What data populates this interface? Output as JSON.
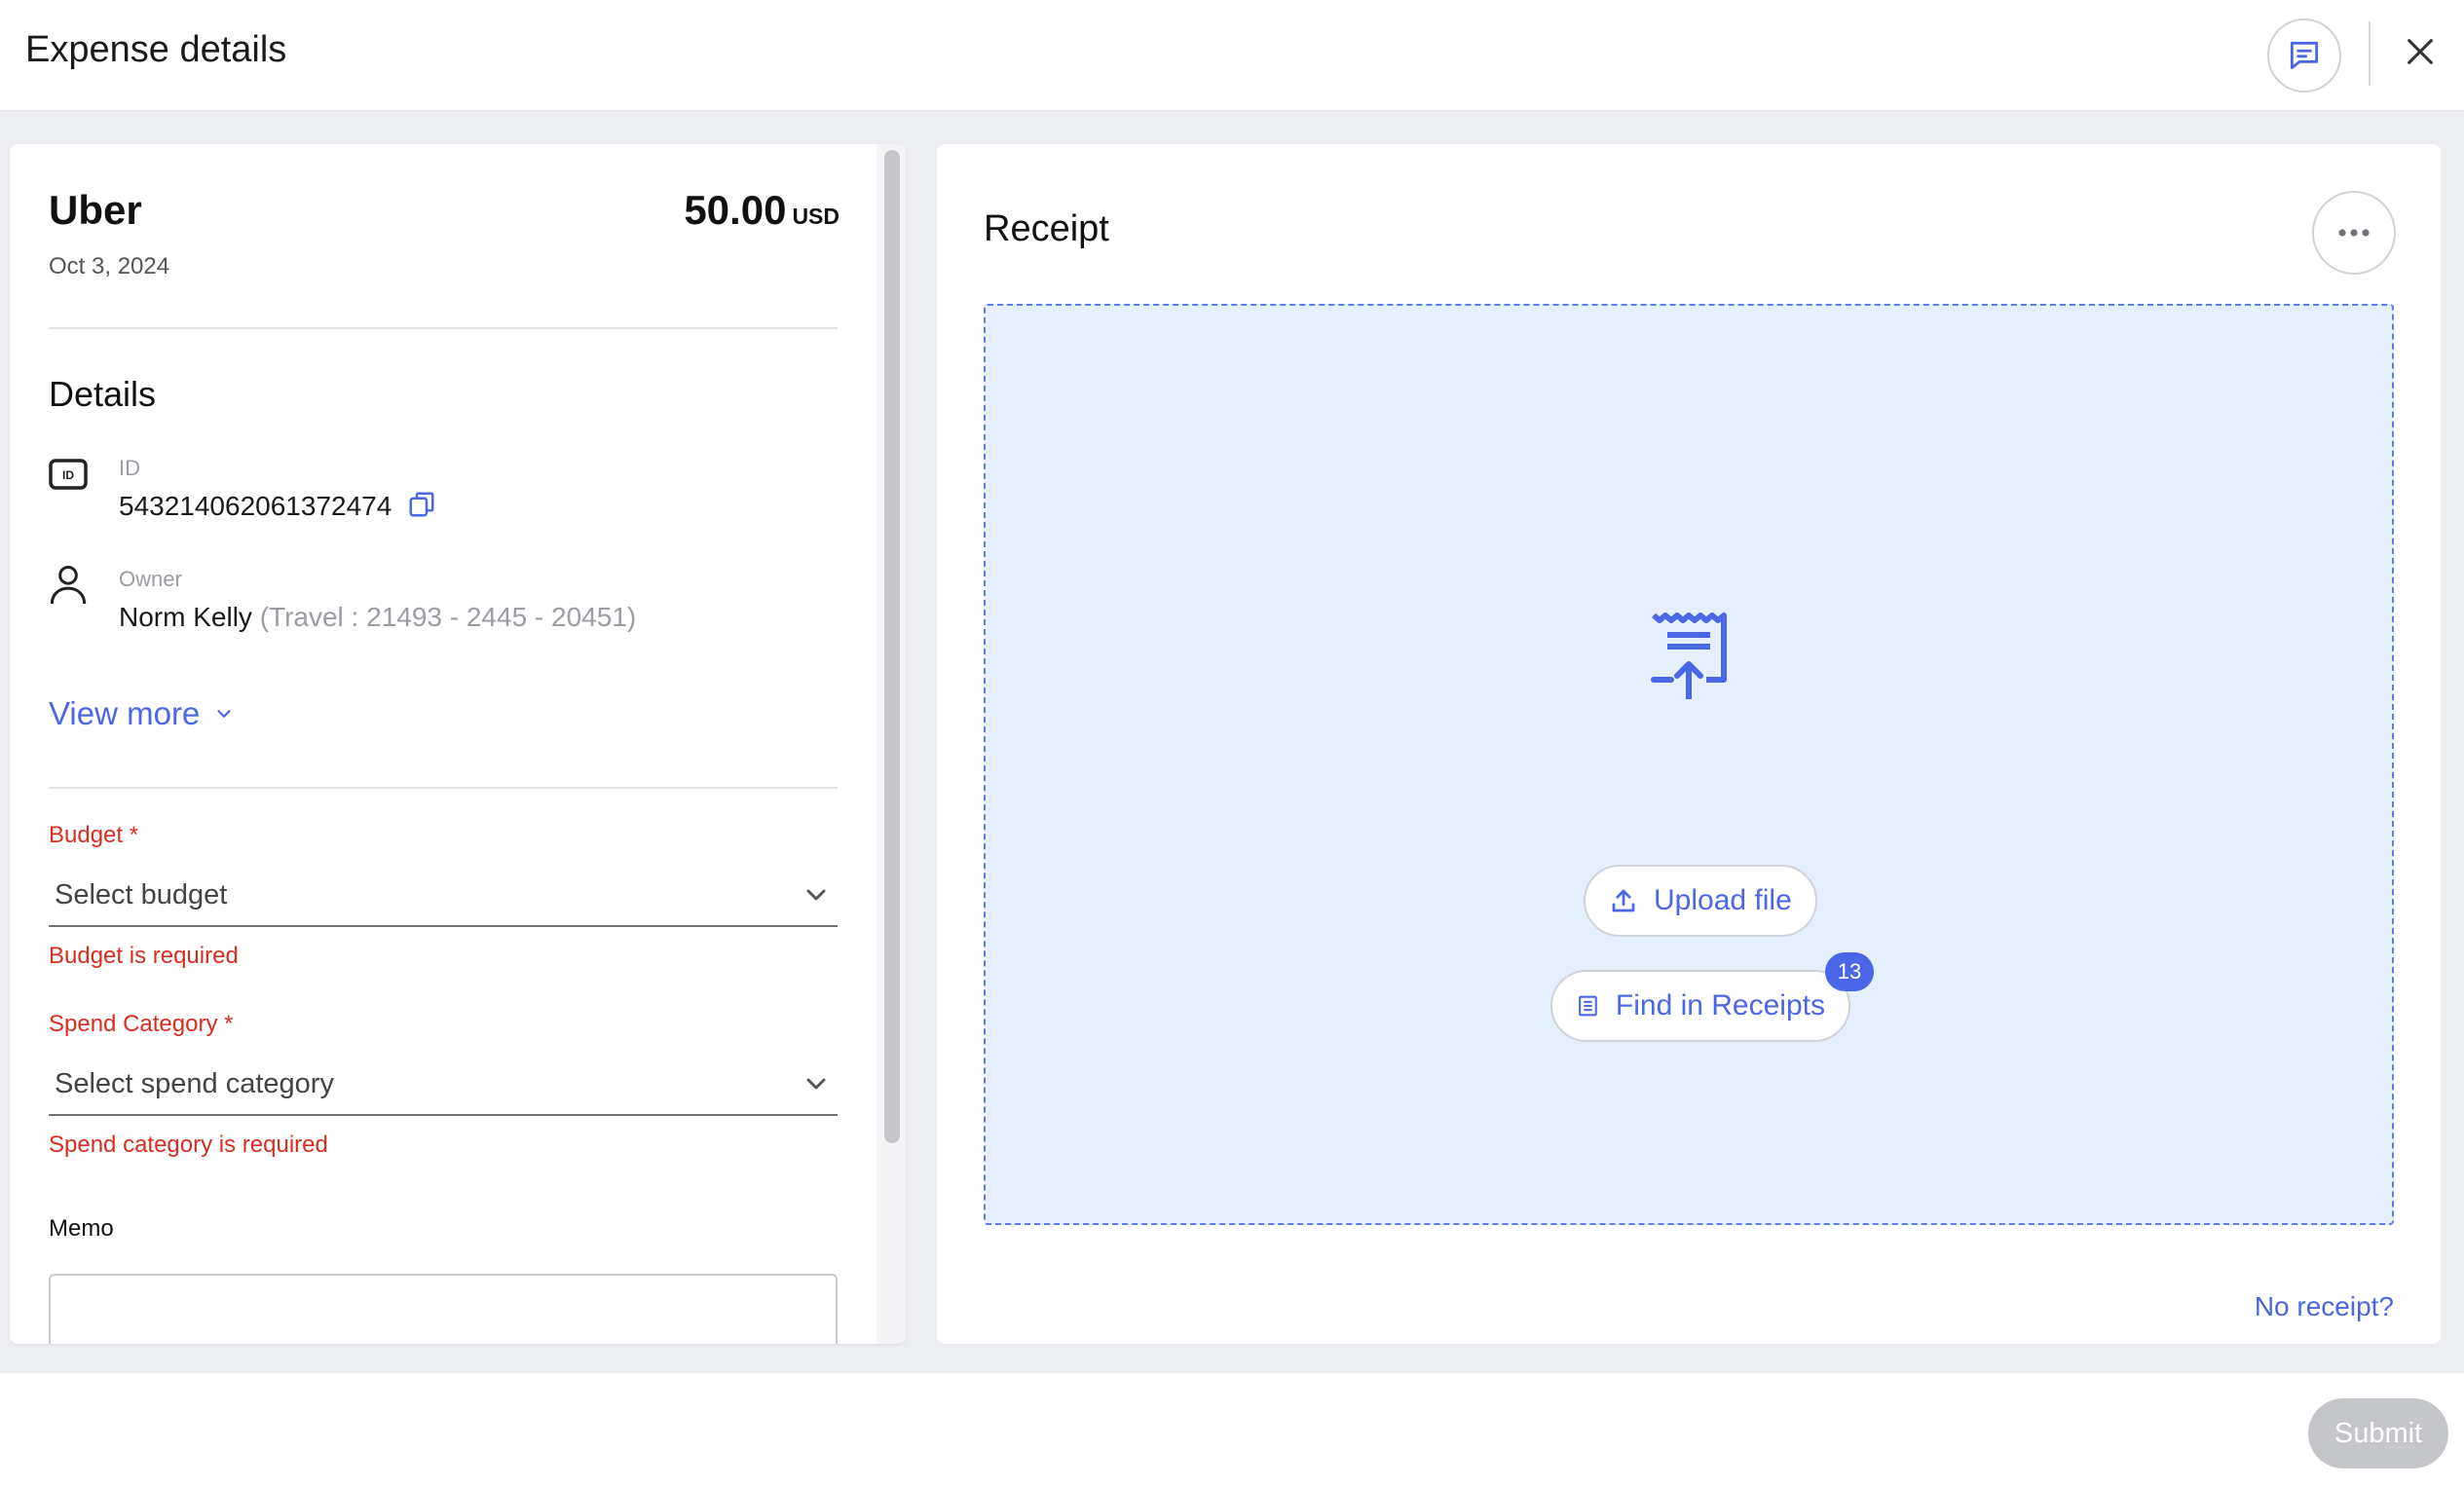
{
  "header": {
    "title": "Expense details",
    "chat_icon": "message-icon",
    "close_icon": "close-icon"
  },
  "expense": {
    "merchant": "Uber",
    "amount": "50.00",
    "currency": "USD",
    "date": "Oct 3, 2024"
  },
  "details": {
    "title": "Details",
    "id_label": "ID",
    "id_value": "543214062061372474",
    "owner_label": "Owner",
    "owner_name": "Norm Kelly",
    "owner_extra": "(Travel : 21493 - 2445 - 20451)",
    "view_more": "View more"
  },
  "form": {
    "budget_label": "Budget *",
    "budget_placeholder": "Select budget",
    "budget_error": "Budget is required",
    "category_label": "Spend Category *",
    "category_placeholder": "Select spend category",
    "category_error": "Spend category is required",
    "memo_label": "Memo"
  },
  "receipt": {
    "title": "Receipt",
    "upload_label": "Upload file",
    "find_label": "Find in Receipts",
    "find_count": "13",
    "no_receipt": "No receipt?"
  },
  "footer": {
    "submit_label": "Submit"
  },
  "colors": {
    "accent": "#4a67e8",
    "error": "#d92d20",
    "dropzone_bg": "#e6f0fd",
    "disabled": "#c4c6ca"
  }
}
